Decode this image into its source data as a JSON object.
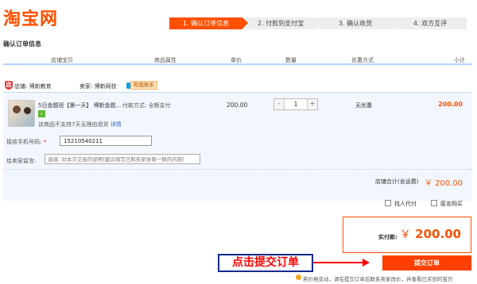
{
  "logo": "淘宝网",
  "steps": [
    "1. 确认订单信息",
    "2. 付款到支付宝",
    "3. 确认收货",
    "4. 双方互评"
  ],
  "section_title": "确认订单信息",
  "columns": [
    "店铺宝贝",
    "商品属性",
    "单价",
    "数量",
    "优惠方式",
    "小计"
  ],
  "shop": {
    "icon": "shop-shield-icon",
    "store_label": "店铺: 博新教育",
    "seller_label": "卖家: 博新网校",
    "badge": "和我联系"
  },
  "item": {
    "title": "5日金题班【第一天】 博新金题...",
    "pay_method": "付款方式: 全额支付",
    "return_note": "该商品不支持7天无理由退货",
    "details_link": "详情",
    "unit_price": "200.00",
    "quantity": "1",
    "minus": "-",
    "plus": "+",
    "discount": "无优惠",
    "subtotal": "200.00"
  },
  "phone": {
    "label": "接收手机号码:",
    "star": "*",
    "value": "15210540211"
  },
  "message": {
    "label": "给卖家留言:",
    "placeholder": "选填: 对本次交易的说明(建议填写已和卖家协商一致的内容)"
  },
  "store_total": {
    "label": "店铺合计(含运费)",
    "value": "￥ 200.00"
  },
  "options": {
    "friend_pay": "找人代付",
    "anonymous": "匿名购买"
  },
  "payment": {
    "label": "实付款:",
    "currency": "￥",
    "amount": "200.00"
  },
  "annotation": "点击提交订单",
  "submit_label": "提交订单",
  "bottom_note": "若价格变动，请在提交订单后联系卖家改价，并查看已买到的宝贝",
  "colors": {
    "accent": "#ff5000",
    "annotation": "#ff0000",
    "link": "#3366cc"
  }
}
